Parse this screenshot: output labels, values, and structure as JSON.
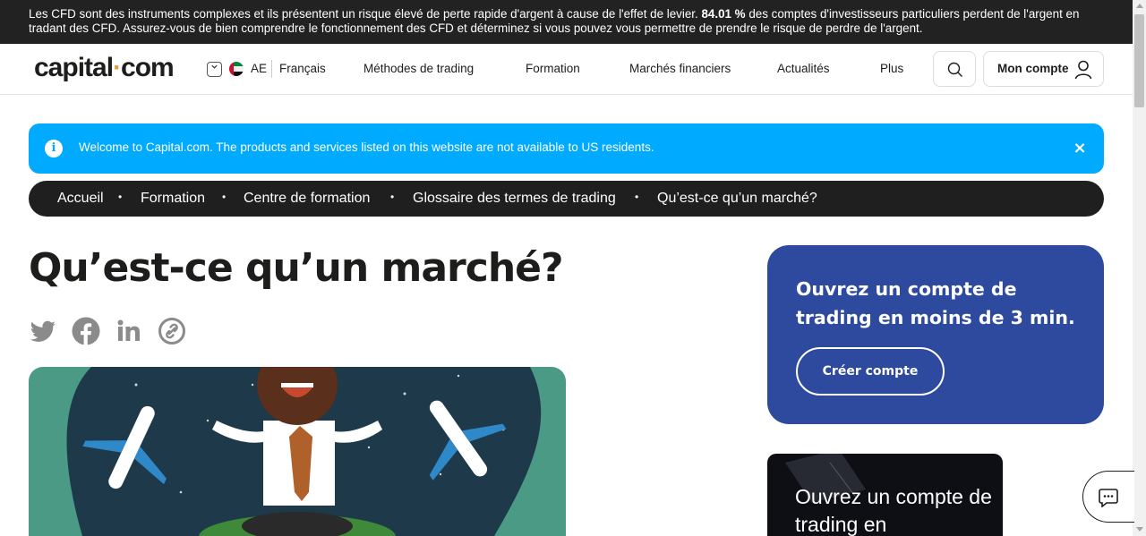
{
  "risk_banner": {
    "text_before": "Les CFD sont des instruments complexes et ils présentent un risque élevé de perte rapide d'argent à cause de l'effet de levier. ",
    "percent": "84.01 %",
    "text_after": " des comptes d'investisseurs particuliers perdent de l'argent en tradant des CFD. Assurez-vous de bien comprendre le fonctionnement des CFD et déterminez si vous pouvez vous permettre de prendre le risque de perdre de l'argent."
  },
  "header": {
    "logo_left": "capital",
    "logo_dot": "·",
    "logo_right": "com",
    "region": "AE",
    "language": "Français",
    "nav": [
      "Méthodes de trading",
      "Formation",
      "Marchés financiers",
      "Actualités",
      "Plus"
    ],
    "account_label": "Mon compte"
  },
  "notice": {
    "message": "Welcome to Capital.com. The products and services listed on this website are not available to US residents.",
    "close": "×",
    "info": "i"
  },
  "breadcrumb": [
    "Accueil",
    "Formation",
    "Centre de formation",
    "Glossaire des termes de trading",
    "Qu’est-ce qu’un marché?"
  ],
  "breadcrumb_sep": "•",
  "page": {
    "title": "Qu’est-ce qu’un marché?"
  },
  "cta": {
    "text": "Ouvrez un compte de trading en moins de 3 min.",
    "button": "Créer compte"
  },
  "promo": {
    "text": "Ouvrez un compte de trading en"
  },
  "colors": {
    "notice_bg": "#00aaff",
    "cta_bg": "#2e4a9e",
    "breadcrumb_bg": "#1f1f1f",
    "hero_bg": "#4a9a86",
    "logo_dot": "#e79c3c"
  },
  "icons": [
    "info-icon",
    "close-icon",
    "search-icon",
    "user-icon",
    "twitter-icon",
    "facebook-icon",
    "linkedin-icon",
    "copy-link-icon",
    "chat-icon",
    "chevron-down-icon"
  ]
}
